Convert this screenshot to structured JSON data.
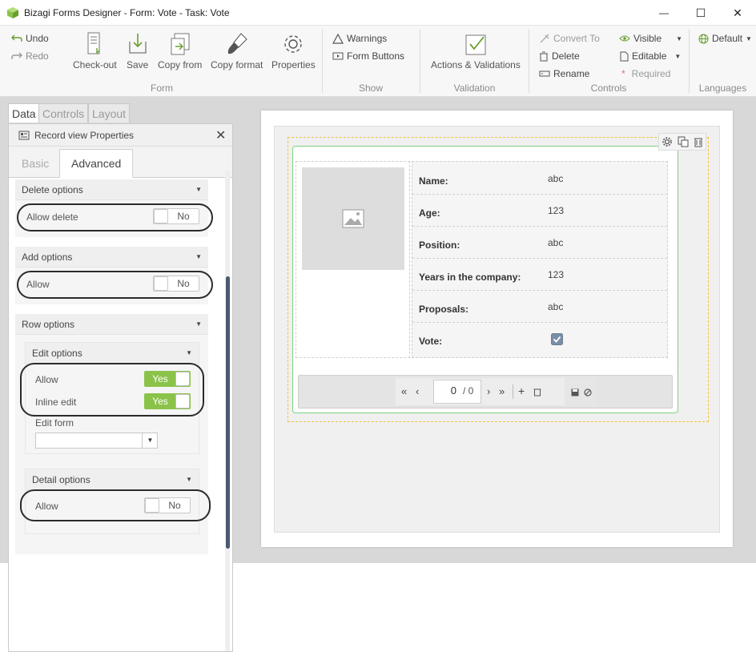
{
  "window": {
    "title": "Bizagi Forms Designer  - Form: Vote - Task:  Vote",
    "minimize_glyph": "—",
    "maximize_glyph": "☐",
    "close_glyph": "✕"
  },
  "ribbon": {
    "undo": "Undo",
    "redo": "Redo",
    "form_buttons": [
      {
        "name": "checkout",
        "label": "Check-out",
        "icon": "checkout-icon"
      },
      {
        "name": "save",
        "label": "Save",
        "icon": "save-icon"
      },
      {
        "name": "copy-from",
        "label": "Copy from",
        "icon": "copy-from-icon"
      },
      {
        "name": "copy-format",
        "label": "Copy format",
        "icon": "paintbrush-icon"
      },
      {
        "name": "properties",
        "label": "Properties",
        "icon": "gear-icon"
      }
    ],
    "groups": {
      "form": "Form",
      "show": "Show",
      "validation": "Validation",
      "controls": "Controls",
      "languages": "Languages"
    },
    "show": {
      "warnings": "Warnings",
      "form_buttons": "Form Buttons"
    },
    "validation": {
      "actions": "Actions & Validations"
    },
    "controls": {
      "convert_to": "Convert To",
      "delete": "Delete",
      "rename": "Rename",
      "visible": "Visible",
      "editable": "Editable",
      "required": "Required"
    },
    "languages": {
      "default": "Default"
    }
  },
  "left_panel": {
    "tabs": [
      "Data",
      "Controls",
      "Layout"
    ],
    "properties_title": "Record view Properties",
    "sub_tabs": [
      "Basic",
      "Advanced"
    ],
    "delete_options": {
      "header": "Delete options",
      "label": "Allow delete",
      "value": "No"
    },
    "add_options": {
      "header": "Add options",
      "label": "Allow",
      "value": "No"
    },
    "row_options": {
      "header": "Row options"
    },
    "edit_options": {
      "header": "Edit options",
      "allow_label": "Allow",
      "allow_value": "Yes",
      "inline_label": "Inline edit",
      "inline_value": "Yes",
      "edit_form_label": "Edit form",
      "edit_form_value": ""
    },
    "detail_options": {
      "header": "Detail options",
      "label": "Allow",
      "value": "No"
    }
  },
  "form": {
    "fields": [
      {
        "label": "Name:",
        "value": "abc"
      },
      {
        "label": "Age:",
        "value": "123"
      },
      {
        "label": "Position:",
        "value": "abc"
      },
      {
        "label": "Years in the company:",
        "value": "123"
      },
      {
        "label": "Proposals:",
        "value": "abc"
      },
      {
        "label": "Vote:",
        "value": ""
      }
    ],
    "vote_checked": true,
    "pager": {
      "current": "0",
      "total": "/ 0"
    }
  },
  "colors": {
    "accent_green": "#8bc34a",
    "selection_orange": "#f0c040",
    "record_border": "#7fd17f"
  }
}
